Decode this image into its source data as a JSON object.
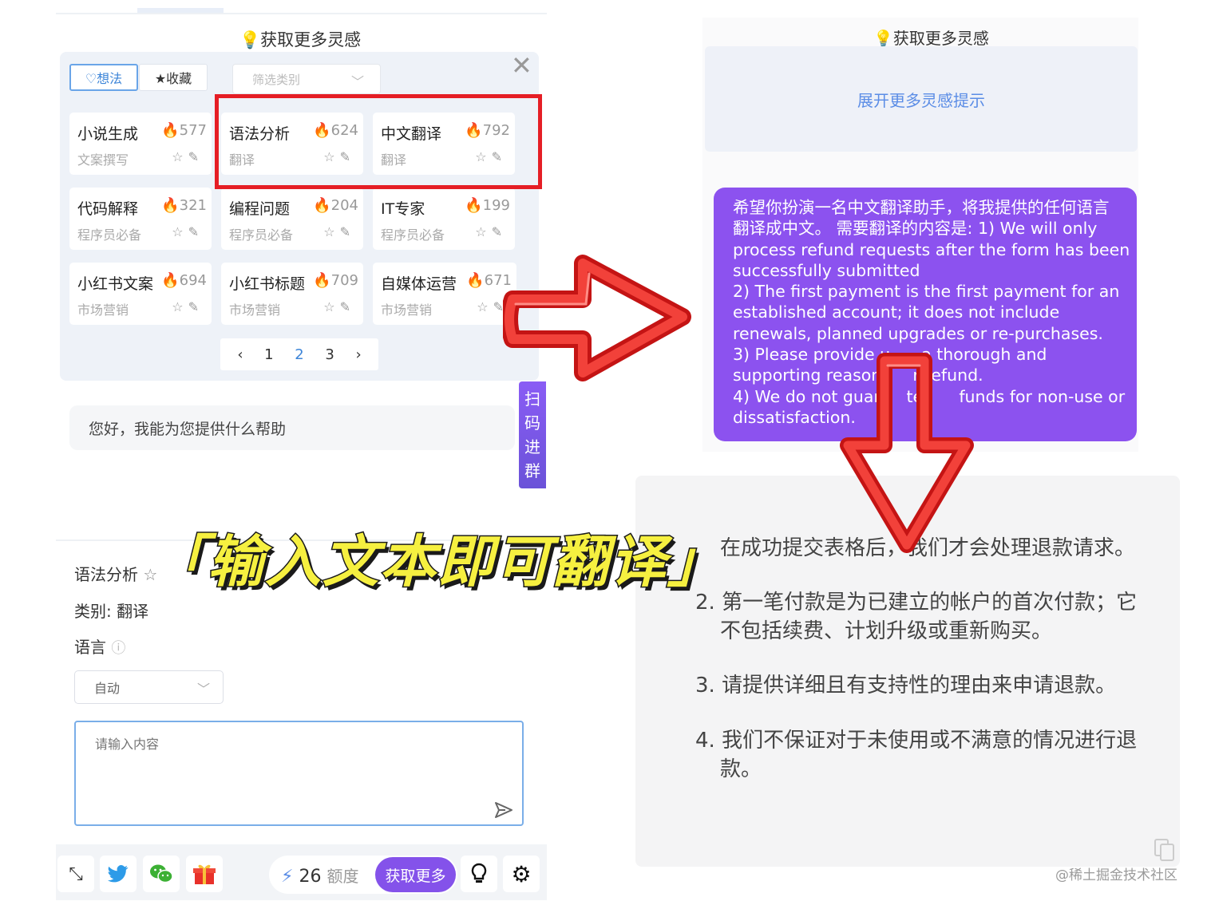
{
  "colors": {
    "accent_blue": "#3d85d8",
    "purple": "#8c52ef",
    "highlight_red": "#e51e25",
    "banner_yellow": "#f6f040"
  },
  "left_panel": {
    "title": "💡获取更多灵感",
    "tabs": [
      "♡想法",
      "★收藏"
    ],
    "filter_placeholder": "筛选类别",
    "cards": [
      {
        "title": "小说生成",
        "hot": "577",
        "category": "文案撰写"
      },
      {
        "title": "语法分析",
        "hot": "624",
        "category": "翻译"
      },
      {
        "title": "中文翻译",
        "hot": "792",
        "category": "翻译"
      },
      {
        "title": "代码解释",
        "hot": "321",
        "category": "程序员必备"
      },
      {
        "title": "编程问题",
        "hot": "204",
        "category": "程序员必备"
      },
      {
        "title": "IT专家",
        "hot": "199",
        "category": "程序员必备"
      },
      {
        "title": "小红书文案",
        "hot": "694",
        "category": "市场营销"
      },
      {
        "title": "小红书标题",
        "hot": "709",
        "category": "市场营销"
      },
      {
        "title": "自媒体运营",
        "hot": "671",
        "category": "市场营销"
      }
    ],
    "pager": {
      "prev": "‹",
      "pages": [
        "1",
        "2",
        "3"
      ],
      "current": "2",
      "next": "›"
    },
    "scan_tab": [
      "扫",
      "码",
      "进",
      "群"
    ],
    "greeting": "您好，我能为您提供什么帮助"
  },
  "form": {
    "name": "语法分析",
    "category": "类别: 翻译",
    "language_label": "语言",
    "language_value": "自动",
    "input_placeholder": "请输入内容"
  },
  "toolbar": {
    "quota_value": "26",
    "quota_unit": "额度",
    "get_more": "获取更多"
  },
  "right_top": {
    "title": "💡获取更多灵感",
    "expand_hint": "展开更多灵感提示",
    "prompt_lines": [
      "希望你扮演一名中文翻译助手，将我提供的任何语言",
      "翻译成中文。 需要翻译的内容是: 1) We will only",
      "process refund requests after the form has been",
      "successfully submitted",
      "2) The first payment is the first payment for an",
      "established account; it does not include",
      "renewals, planned upgrades or re-purchases.",
      "3) Please provide u      a thorough and",
      "supporting reason      r refund.",
      "4) We do not guar     tee     funds for non-use or",
      "dissatisfaction."
    ]
  },
  "right_bottom": {
    "lines": [
      "在成功提交表格后，我们才会处理退款请求。",
      "2. 第一笔付款是为已建立的帐户的首次付款；它",
      "不包括续费、计划升级或重新购买。",
      "3. 请提供详细且有支持性的理由来申请退款。",
      "4. 我们不保证对于未使用或不满意的情况进行退",
      "款。"
    ],
    "watermark": "@稀土掘金技术社区"
  },
  "banner": "「输入文本即可翻译」"
}
